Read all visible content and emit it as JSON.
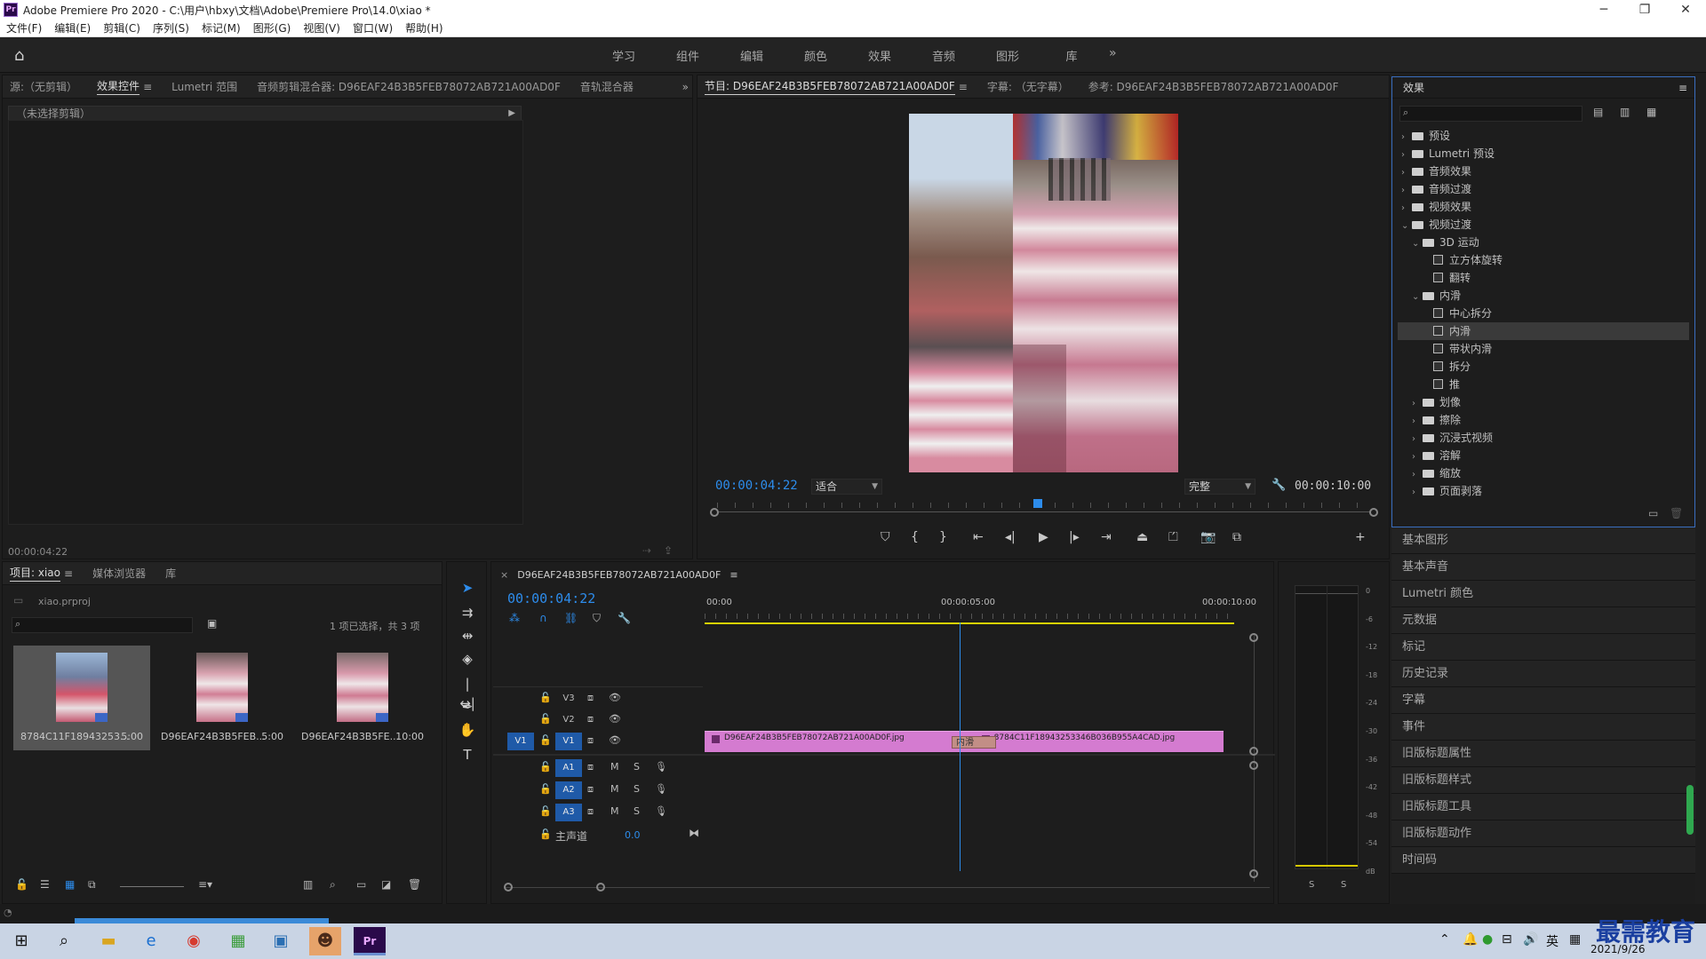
{
  "window": {
    "title": "Adobe Premiere Pro 2020 - C:\\用户\\hbxy\\文档\\Adobe\\Premiere Pro\\14.0\\xiao *",
    "logo": "Pr",
    "minimize": "─",
    "maximize": "❐",
    "close": "✕"
  },
  "menu": [
    "文件(F)",
    "编辑(E)",
    "剪辑(C)",
    "序列(S)",
    "标记(M)",
    "图形(G)",
    "视图(V)",
    "窗口(W)",
    "帮助(H)"
  ],
  "workspaces": [
    "学习",
    "组件",
    "编辑",
    "颜色",
    "效果",
    "音频",
    "图形",
    "库"
  ],
  "workspace_more": "»",
  "effect_controls": {
    "tabs": [
      "源:（无剪辑）",
      "效果控件",
      "Lumetri 范围",
      "音频剪辑混合器: D96EAF24B3B5FEB78072AB721A00AD0F",
      "音轨混合器"
    ],
    "active_tab": "效果控件",
    "no_clip": "（未选择剪辑）",
    "timecode": "00:00:04:22"
  },
  "program": {
    "tabs": [
      "节目: D96EAF24B3B5FEB78072AB721A00AD0F",
      "字幕: （无字幕）",
      "参考: D96EAF24B3B5FEB78072AB721A00AD0F"
    ],
    "timecode": "00:00:04:22",
    "fit": "适合",
    "quality": "完整",
    "duration": "00:00:10:00",
    "playhead_fraction": 0.49
  },
  "effects": {
    "title": "效果",
    "tree": [
      {
        "label": "预设",
        "level": 0,
        "type": "folder",
        "open": false
      },
      {
        "label": "Lumetri 预设",
        "level": 0,
        "type": "folder",
        "open": false
      },
      {
        "label": "音频效果",
        "level": 0,
        "type": "folder",
        "open": false
      },
      {
        "label": "音频过渡",
        "level": 0,
        "type": "folder",
        "open": false
      },
      {
        "label": "视频效果",
        "level": 0,
        "type": "folder",
        "open": false
      },
      {
        "label": "视频过渡",
        "level": 0,
        "type": "folder",
        "open": true
      },
      {
        "label": "3D 运动",
        "level": 1,
        "type": "folder",
        "open": true
      },
      {
        "label": "立方体旋转",
        "level": 2,
        "type": "fx"
      },
      {
        "label": "翻转",
        "level": 2,
        "type": "fx"
      },
      {
        "label": "内滑",
        "level": 1,
        "type": "folder",
        "open": true
      },
      {
        "label": "中心拆分",
        "level": 2,
        "type": "fx"
      },
      {
        "label": "内滑",
        "level": 2,
        "type": "fx",
        "selected": true
      },
      {
        "label": "带状内滑",
        "level": 2,
        "type": "fx"
      },
      {
        "label": "拆分",
        "level": 2,
        "type": "fx"
      },
      {
        "label": "推",
        "level": 2,
        "type": "fx"
      },
      {
        "label": "划像",
        "level": 1,
        "type": "folder",
        "open": false
      },
      {
        "label": "擦除",
        "level": 1,
        "type": "folder",
        "open": false
      },
      {
        "label": "沉浸式视频",
        "level": 1,
        "type": "folder",
        "open": false
      },
      {
        "label": "溶解",
        "level": 1,
        "type": "folder",
        "open": false
      },
      {
        "label": "缩放",
        "level": 1,
        "type": "folder",
        "open": false
      },
      {
        "label": "页面剥落",
        "level": 1,
        "type": "folder",
        "open": false
      }
    ]
  },
  "side_panels": [
    "基本图形",
    "基本声音",
    "Lumetri 颜色",
    "元数据",
    "标记",
    "历史记录",
    "字幕",
    "事件",
    "旧版标题属性",
    "旧版标题样式",
    "旧版标题工具",
    "旧版标题动作",
    "时间码"
  ],
  "project": {
    "tabs": [
      "项目: xiao",
      "媒体浏览器",
      "库"
    ],
    "file": "xiao.prproj",
    "selection": "1 项已选择，共 3 项",
    "items": [
      {
        "name": "8784C11F18943253...",
        "dur": "5:00",
        "selected": true
      },
      {
        "name": "D96EAF24B3B5FEB...",
        "dur": "5:00",
        "selected": false
      },
      {
        "name": "D96EAF24B3B5FE...",
        "dur": "10:00",
        "selected": false
      }
    ]
  },
  "timeline": {
    "tab": "D96EAF24B3B5FEB78072AB721A00AD0F",
    "close": "×",
    "timecode": "00:00:04:22",
    "ruler": [
      "00:00",
      "00:00:05:00",
      "00:00:10:00"
    ],
    "tracks_video": [
      "V3",
      "V2",
      "V1"
    ],
    "tracks_audio": [
      "A1",
      "A2",
      "A3"
    ],
    "master": "主声道",
    "master_value": "0.0",
    "source_v": "V1",
    "clips": [
      {
        "label": "D96EAF24B3B5FEB78072AB721A00AD0F.jpg",
        "start": 0,
        "end": 5.2
      },
      {
        "label": "8784C11F18943253346B036B955A4CAD.jpg",
        "start": 5.2,
        "end": 10
      }
    ],
    "transition": "内滑",
    "playhead_seconds": 4.92
  },
  "meter": {
    "scale": [
      "0",
      "-6",
      "-12",
      "-18",
      "-24",
      "-30",
      "-36",
      "-42",
      "-48",
      "-54",
      "dB"
    ],
    "solo": [
      "S",
      "S"
    ]
  },
  "taskbar": {
    "date": "2021/9/26",
    "ime": "英",
    "watermark": "最需教育"
  }
}
